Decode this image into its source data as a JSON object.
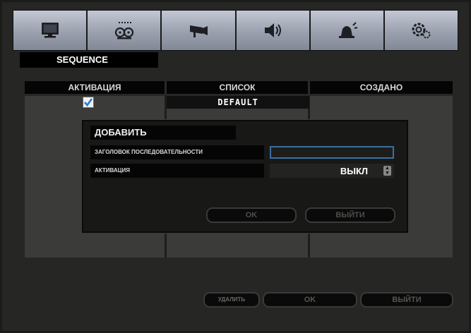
{
  "tabs": [
    {
      "icon": "monitor-icon"
    },
    {
      "icon": "recording-reels-icon"
    },
    {
      "icon": "camera-icon"
    },
    {
      "icon": "speaker-icon"
    },
    {
      "icon": "alarm-siren-icon"
    },
    {
      "icon": "settings-gear-icon"
    }
  ],
  "section": {
    "title": "SEQUENCE"
  },
  "table": {
    "headers": [
      "АКТИВАЦИЯ",
      "СПИСОК",
      "СОЗДАНО"
    ],
    "rows": [
      {
        "activated": true,
        "list": "DEFAULT",
        "created": ""
      }
    ]
  },
  "dialog": {
    "title": "ДОБАВИТЬ",
    "title_label": "ЗАГОЛОВОК ПОСЛЕДОВАТЕЛЬНОСТИ",
    "title_value": "",
    "activation_label": "АКТИВАЦИЯ",
    "activation_value": "ВЫКЛ",
    "ok_label": "OK",
    "exit_label": "ВЫЙТИ"
  },
  "footer": {
    "delete_label": "УДАЛИТЬ",
    "ok_label": "OK",
    "exit_label": "ВЫЙТИ"
  },
  "colors": {
    "accent_focus": "#3b6f9e",
    "tab_bar": "#a4a9b6",
    "panel": "#3b3c39"
  }
}
